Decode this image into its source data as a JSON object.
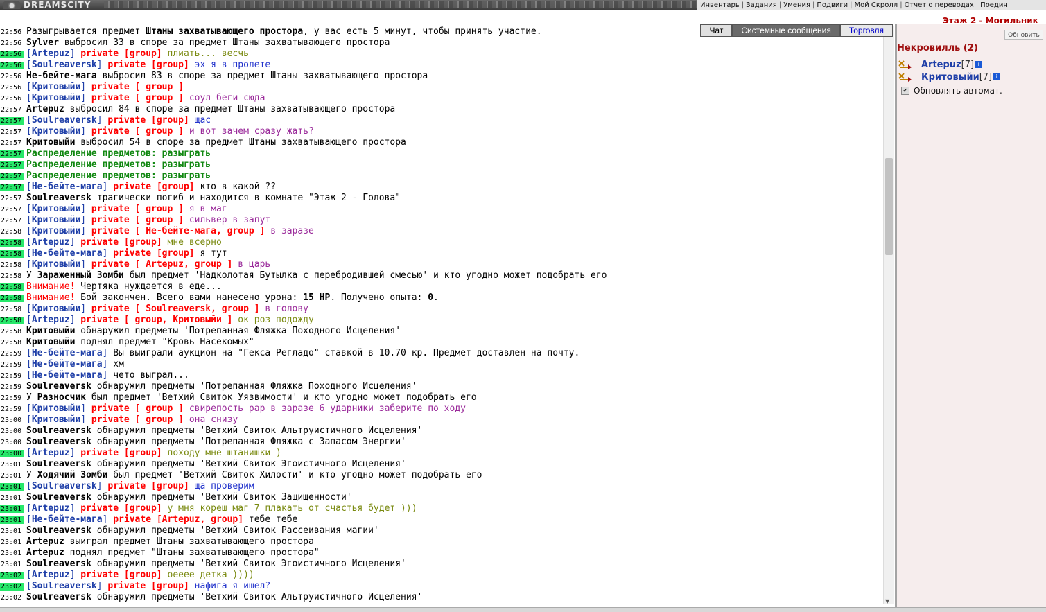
{
  "header": {
    "logo": "DREAMSCITY",
    "nav": [
      "Инвентарь",
      "Задания",
      "Умения",
      "Подвиги",
      "Мой Скролл",
      "Отчет о переводах",
      "Поедин"
    ],
    "location": "Этаж 2 - Могильник"
  },
  "tabs": {
    "chat": "Чат",
    "system": "Системные сообщения",
    "trade": "Торговля"
  },
  "chat": {
    "lines": [
      {
        "t": "22:56",
        "hl": false,
        "s": [
          [
            "",
            "Разыгрывается предмет "
          ],
          [
            "b",
            "Штаны захватывающего простора"
          ],
          [
            "",
            ", у вас есть 5 минут, чтобы принять участие."
          ]
        ]
      },
      {
        "t": "22:56",
        "hl": false,
        "s": [
          [
            "b",
            "Sylver"
          ],
          [
            "",
            " выбросил 33 в споре за предмет Штаны захватывающего простора"
          ]
        ]
      },
      {
        "t": "22:56",
        "hl": true,
        "s": [
          [
            "br",
            "["
          ],
          [
            "nick",
            "Artepuz"
          ],
          [
            "br",
            "]"
          ],
          [
            "priv",
            " private [group]"
          ],
          [
            "m-green",
            " плиать... весчь"
          ]
        ]
      },
      {
        "t": "22:56",
        "hl": true,
        "s": [
          [
            "br",
            "["
          ],
          [
            "nick",
            "Soulreaversk"
          ],
          [
            "br",
            "]"
          ],
          [
            "priv",
            " private [group]"
          ],
          [
            "m-blue",
            " эх я в пролете"
          ]
        ]
      },
      {
        "t": "22:56",
        "hl": false,
        "s": [
          [
            "b",
            "Не-бейте-мага"
          ],
          [
            "",
            " выбросил 83 в споре за предмет Штаны захватывающего простора"
          ]
        ]
      },
      {
        "t": "22:56",
        "hl": false,
        "s": [
          [
            "br",
            "["
          ],
          [
            "nick",
            "Критовыйи"
          ],
          [
            "br",
            "]"
          ],
          [
            "priv",
            " private [ group ]"
          ]
        ]
      },
      {
        "t": "22:56",
        "hl": false,
        "s": [
          [
            "br",
            "["
          ],
          [
            "nick",
            "Критовыйи"
          ],
          [
            "br",
            "]"
          ],
          [
            "priv",
            " private [ group ]"
          ],
          [
            "m-purple",
            " соул беги сюда"
          ]
        ]
      },
      {
        "t": "22:57",
        "hl": false,
        "s": [
          [
            "b",
            "Artepuz"
          ],
          [
            "",
            " выбросил 84 в споре за предмет Штаны захватывающего простора"
          ]
        ]
      },
      {
        "t": "22:57",
        "hl": true,
        "s": [
          [
            "br",
            "["
          ],
          [
            "nick",
            "Soulreaversk"
          ],
          [
            "br",
            "]"
          ],
          [
            "priv",
            " private [group]"
          ],
          [
            "m-blue",
            " щас"
          ]
        ]
      },
      {
        "t": "22:57",
        "hl": false,
        "s": [
          [
            "br",
            "["
          ],
          [
            "nick",
            "Критовыйи"
          ],
          [
            "br",
            "]"
          ],
          [
            "priv",
            " private [ group ]"
          ],
          [
            "m-purple",
            " и вот зачем сразу жать?"
          ]
        ]
      },
      {
        "t": "22:57",
        "hl": false,
        "s": [
          [
            "b",
            "Критовыйи"
          ],
          [
            "",
            " выбросил 54 в споре за предмет Штаны захватывающего простора"
          ]
        ]
      },
      {
        "t": "22:57",
        "hl": true,
        "s": [
          [
            "dist",
            "Распределение предметов: разыграть"
          ]
        ]
      },
      {
        "t": "22:57",
        "hl": true,
        "s": [
          [
            "dist",
            "Распределение предметов: разыграть"
          ]
        ]
      },
      {
        "t": "22:57",
        "hl": true,
        "s": [
          [
            "dist",
            "Распределение предметов: разыграть"
          ]
        ]
      },
      {
        "t": "22:57",
        "hl": true,
        "s": [
          [
            "br",
            "["
          ],
          [
            "nick",
            "Не-бейте-мага"
          ],
          [
            "br",
            "]"
          ],
          [
            "priv",
            " private [group]"
          ],
          [
            "",
            " кто в какой ??"
          ]
        ]
      },
      {
        "t": "22:57",
        "hl": false,
        "s": [
          [
            "b",
            "Soulreaversk"
          ],
          [
            "",
            " трагически погиб и находится в комнате \"Этаж 2 - Голова\""
          ]
        ]
      },
      {
        "t": "22:57",
        "hl": false,
        "s": [
          [
            "br",
            "["
          ],
          [
            "nick",
            "Критовыйи"
          ],
          [
            "br",
            "]"
          ],
          [
            "priv",
            " private [ group ]"
          ],
          [
            "m-purple",
            " я в маг"
          ]
        ]
      },
      {
        "t": "22:57",
        "hl": false,
        "s": [
          [
            "br",
            "["
          ],
          [
            "nick",
            "Критовыйи"
          ],
          [
            "br",
            "]"
          ],
          [
            "priv",
            " private [ group ]"
          ],
          [
            "m-purple",
            " сильвер в запут"
          ]
        ]
      },
      {
        "t": "22:58",
        "hl": false,
        "s": [
          [
            "br",
            "["
          ],
          [
            "nick",
            "Критовыйи"
          ],
          [
            "br",
            "]"
          ],
          [
            "priv",
            " private [ Не-бейте-мага, group ]"
          ],
          [
            "m-purple",
            " в заразе"
          ]
        ]
      },
      {
        "t": "22:58",
        "hl": true,
        "s": [
          [
            "br",
            "["
          ],
          [
            "nick",
            "Artepuz"
          ],
          [
            "br",
            "]"
          ],
          [
            "priv",
            " private [group]"
          ],
          [
            "m-green",
            " мне всерно"
          ]
        ]
      },
      {
        "t": "22:58",
        "hl": true,
        "s": [
          [
            "br",
            "["
          ],
          [
            "nick",
            "Не-бейте-мага"
          ],
          [
            "br",
            "]"
          ],
          [
            "priv",
            " private [group]"
          ],
          [
            "",
            " я тут"
          ]
        ]
      },
      {
        "t": "22:58",
        "hl": false,
        "s": [
          [
            "br",
            "["
          ],
          [
            "nick",
            "Критовыйи"
          ],
          [
            "br",
            "]"
          ],
          [
            "priv",
            " private [ Artepuz, group ]"
          ],
          [
            "m-purple",
            " в царь"
          ]
        ]
      },
      {
        "t": "22:58",
        "hl": false,
        "s": [
          [
            "",
            "У "
          ],
          [
            "b",
            "Зараженный Зомби"
          ],
          [
            "",
            " был предмет 'Надколотая Бутылка с перебродившей смесью' и кто угодно может подобрать его"
          ]
        ]
      },
      {
        "t": "22:58",
        "hl": true,
        "s": [
          [
            "warn",
            "Внимание!"
          ],
          [
            "",
            " Чертяка нуждается в еде..."
          ]
        ]
      },
      {
        "t": "22:58",
        "hl": true,
        "s": [
          [
            "warn",
            "Внимание!"
          ],
          [
            "",
            " Бой закончен. Всего вами нанесено урона: "
          ],
          [
            "b",
            "15 HP"
          ],
          [
            "",
            ". Получено опыта: "
          ],
          [
            "b",
            "0"
          ],
          [
            "",
            "."
          ]
        ]
      },
      {
        "t": "22:58",
        "hl": false,
        "s": [
          [
            "br",
            "["
          ],
          [
            "nick",
            "Критовыйи"
          ],
          [
            "br",
            "]"
          ],
          [
            "priv",
            " private [ Soulreaversk, group ]"
          ],
          [
            "m-purple",
            " в голову"
          ]
        ]
      },
      {
        "t": "22:58",
        "hl": true,
        "s": [
          [
            "br",
            "["
          ],
          [
            "nick",
            "Artepuz"
          ],
          [
            "br",
            "]"
          ],
          [
            "priv",
            " private [ group, Критовыйи ]"
          ],
          [
            "m-green",
            " ок роз подожду"
          ]
        ]
      },
      {
        "t": "22:58",
        "hl": false,
        "s": [
          [
            "b",
            "Критовыйи"
          ],
          [
            "",
            " обнаружил предметы 'Потрепанная Фляжка Походного Исцеления'"
          ]
        ]
      },
      {
        "t": "22:58",
        "hl": false,
        "s": [
          [
            "b",
            "Критовыйи"
          ],
          [
            "",
            " поднял предмет \"Кровь Насекомых\""
          ]
        ]
      },
      {
        "t": "22:59",
        "hl": false,
        "s": [
          [
            "br",
            "["
          ],
          [
            "nick",
            "Не-бейте-мага"
          ],
          [
            "br",
            "]"
          ],
          [
            "",
            " Вы выиграли аукцион на \"Гекса Регладо\" ставкой в 10.70 кр. Предмет доставлен на почту."
          ]
        ]
      },
      {
        "t": "22:59",
        "hl": false,
        "s": [
          [
            "br",
            "["
          ],
          [
            "nick",
            "Не-бейте-мага"
          ],
          [
            "br",
            "]"
          ],
          [
            "",
            " хм"
          ]
        ]
      },
      {
        "t": "22:59",
        "hl": false,
        "s": [
          [
            "br",
            "["
          ],
          [
            "nick",
            "Не-бейте-мага"
          ],
          [
            "br",
            "]"
          ],
          [
            "",
            " чето выграл..."
          ]
        ]
      },
      {
        "t": "22:59",
        "hl": false,
        "s": [
          [
            "b",
            "Soulreaversk"
          ],
          [
            "",
            " обнаружил предметы 'Потрепанная Фляжка Походного Исцеления'"
          ]
        ]
      },
      {
        "t": "22:59",
        "hl": false,
        "s": [
          [
            "",
            "У "
          ],
          [
            "b",
            "Разносчик"
          ],
          [
            "",
            " был предмет 'Ветхий Свиток Уязвимости' и кто угодно может подобрать его"
          ]
        ]
      },
      {
        "t": "22:59",
        "hl": false,
        "s": [
          [
            "br",
            "["
          ],
          [
            "nick",
            "Критовыйи"
          ],
          [
            "br",
            "]"
          ],
          [
            "priv",
            " private [ group ]"
          ],
          [
            "m-purple",
            " свирепость рар в заразе 6 ударники заберите по ходу"
          ]
        ]
      },
      {
        "t": "23:00",
        "hl": false,
        "s": [
          [
            "br",
            "["
          ],
          [
            "nick",
            "Критовыйи"
          ],
          [
            "br",
            "]"
          ],
          [
            "priv",
            " private [ group ]"
          ],
          [
            "m-purple",
            " она снизу"
          ]
        ]
      },
      {
        "t": "23:00",
        "hl": false,
        "s": [
          [
            "b",
            "Soulreaversk"
          ],
          [
            "",
            " обнаружил предметы 'Ветхий Свиток Альтруистичного Исцеления'"
          ]
        ]
      },
      {
        "t": "23:00",
        "hl": false,
        "s": [
          [
            "b",
            "Soulreaversk"
          ],
          [
            "",
            " обнаружил предметы 'Потрепанная Фляжка с Запасом Энергии'"
          ]
        ]
      },
      {
        "t": "23:00",
        "hl": true,
        "s": [
          [
            "br",
            "["
          ],
          [
            "nick",
            "Artepuz"
          ],
          [
            "br",
            "]"
          ],
          [
            "priv",
            " private [group]"
          ],
          [
            "m-green",
            " походу мне штанишки )"
          ]
        ]
      },
      {
        "t": "23:01",
        "hl": false,
        "s": [
          [
            "b",
            "Soulreaversk"
          ],
          [
            "",
            " обнаружил предметы 'Ветхий Свиток Эгоистичного Исцеления'"
          ]
        ]
      },
      {
        "t": "23:01",
        "hl": false,
        "s": [
          [
            "",
            "У "
          ],
          [
            "b",
            "Ходячий Зомби"
          ],
          [
            "",
            " был предмет 'Ветхий Свиток Хилости' и кто угодно может подобрать его"
          ]
        ]
      },
      {
        "t": "23:01",
        "hl": true,
        "s": [
          [
            "br",
            "["
          ],
          [
            "nick",
            "Soulreaversk"
          ],
          [
            "br",
            "]"
          ],
          [
            "priv",
            " private [group]"
          ],
          [
            "m-blue",
            " ща проверим"
          ]
        ]
      },
      {
        "t": "23:01",
        "hl": false,
        "s": [
          [
            "b",
            "Soulreaversk"
          ],
          [
            "",
            " обнаружил предметы 'Ветхий Свиток Защищенности'"
          ]
        ]
      },
      {
        "t": "23:01",
        "hl": true,
        "s": [
          [
            "br",
            "["
          ],
          [
            "nick",
            "Artepuz"
          ],
          [
            "br",
            "]"
          ],
          [
            "priv",
            " private [group]"
          ],
          [
            "m-green",
            " у мня кореш маг 7 плакать от счастья будет )))"
          ]
        ]
      },
      {
        "t": "23:01",
        "hl": true,
        "s": [
          [
            "br",
            "["
          ],
          [
            "nick",
            "Не-бейте-мага"
          ],
          [
            "br",
            "]"
          ],
          [
            "priv",
            " private [Artepuz, group]"
          ],
          [
            "",
            " тебе тебе"
          ]
        ]
      },
      {
        "t": "23:01",
        "hl": false,
        "s": [
          [
            "b",
            "Soulreaversk"
          ],
          [
            "",
            " обнаружил предметы 'Ветхий Свиток Рассеивания магии'"
          ]
        ]
      },
      {
        "t": "23:01",
        "hl": false,
        "s": [
          [
            "b",
            "Artepuz"
          ],
          [
            "",
            " выиграл предмет Штаны захватывающего простора"
          ]
        ]
      },
      {
        "t": "23:01",
        "hl": false,
        "s": [
          [
            "b",
            "Artepuz"
          ],
          [
            "",
            " поднял предмет \"Штаны захватывающего простора\""
          ]
        ]
      },
      {
        "t": "23:01",
        "hl": false,
        "s": [
          [
            "b",
            "Soulreaversk"
          ],
          [
            "",
            " обнаружил предметы 'Ветхий Свиток Эгоистичного Исцеления'"
          ]
        ]
      },
      {
        "t": "23:02",
        "hl": true,
        "s": [
          [
            "br",
            "["
          ],
          [
            "nick",
            "Artepuz"
          ],
          [
            "br",
            "]"
          ],
          [
            "priv",
            " private [group]"
          ],
          [
            "m-green",
            " оееее детка ))))"
          ]
        ]
      },
      {
        "t": "23:02",
        "hl": true,
        "s": [
          [
            "br",
            "["
          ],
          [
            "nick",
            "Soulreaversk"
          ],
          [
            "br",
            "]"
          ],
          [
            "priv",
            " private [group]"
          ],
          [
            "m-blue",
            " нафига я ишел?"
          ]
        ]
      },
      {
        "t": "23:02",
        "hl": false,
        "s": [
          [
            "b",
            "Soulreaversk"
          ],
          [
            "",
            " обнаружил предметы 'Ветхий Свиток Альтруистичного Исцеления'"
          ]
        ]
      }
    ]
  },
  "side": {
    "refresh": "Обновить",
    "room": "Некровилль (2)",
    "players": [
      {
        "name": "Artepuz",
        "level": "[7]",
        "info": "i"
      },
      {
        "name": "Критовыйи",
        "level": "[7]",
        "info": "i"
      }
    ],
    "auto": "Обновлять автомат.",
    "auto_mark": "✔"
  },
  "icons": {
    "player": "crossed-swords-arrow-icon",
    "info": "info-icon"
  }
}
